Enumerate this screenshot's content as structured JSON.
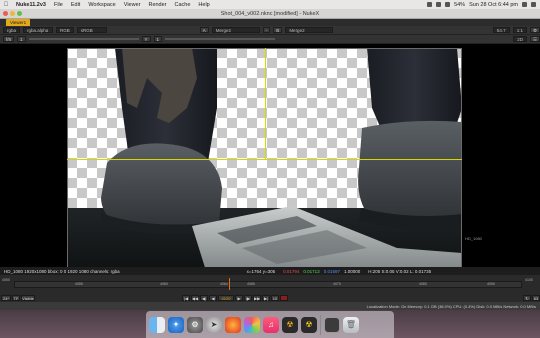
{
  "menubar": {
    "app_name": "NukeX",
    "items": [
      "Nuke11.2v3",
      "File",
      "Edit",
      "Workspace",
      "Viewer",
      "Render",
      "Cache",
      "Help"
    ],
    "battery": "54%",
    "clock": "Sun 28 Oct  6:44 pm"
  },
  "window": {
    "title": "Shot_004_v002.nknc [modified] - NukeX"
  },
  "tab": {
    "label": "Viewer1"
  },
  "viewer_toolbar": {
    "channels": "rgba",
    "alpha": "rgba.alpha",
    "display": "RGB",
    "colorspace": "sRGB",
    "input_a_label": "A",
    "input_a": "Merge2",
    "input_b_label": "B",
    "input_b": "Merge2",
    "zoom": "54.7",
    "ratio": "1:1",
    "view_mode": "2D",
    "gain_label": "f/8",
    "gain_value": "1",
    "gamma_label": "Y",
    "gamma_value": "1"
  },
  "viewer": {
    "format_label": "HD_1080"
  },
  "infobar": {
    "format": "HD_1080 1920x1080  bbox: 0 0 1920 1080 channels: rgba",
    "coords": "x=1764 y=305",
    "r": "0.01794",
    "g": "0.01713",
    "b": "0.01697",
    "a": "1.00000",
    "hsvl": "H:205 S:0.05 V:0.02  L: 0.01735"
  },
  "timeline": {
    "start": "4050",
    "ticks": [
      "4050",
      "4055",
      "4060",
      "4064",
      "4065",
      "4070",
      "4075",
      "4080",
      "4085",
      "4090"
    ],
    "end": "4100"
  },
  "playback": {
    "fps_label": "24*",
    "tf_label": "TF",
    "visible_label": "Visible",
    "current_frame": "4120",
    "step": "10",
    "end_frame": "63"
  },
  "statusbar": {
    "text": "Localization Mode: On  Memory: 0.1 GB (38.0%)  CPU: (0.4%)  Disk: 0.0 MB/s  Network: 0.0 MB/s"
  },
  "dock": {
    "icons": [
      "finder-icon",
      "safari-icon",
      "system-preferences-icon",
      "launchpad-icon",
      "firefox-icon",
      "photos-icon",
      "music-icon",
      "nuke-icon",
      "nuke-studio-icon",
      "finder-window-icon",
      "trash-icon"
    ]
  }
}
